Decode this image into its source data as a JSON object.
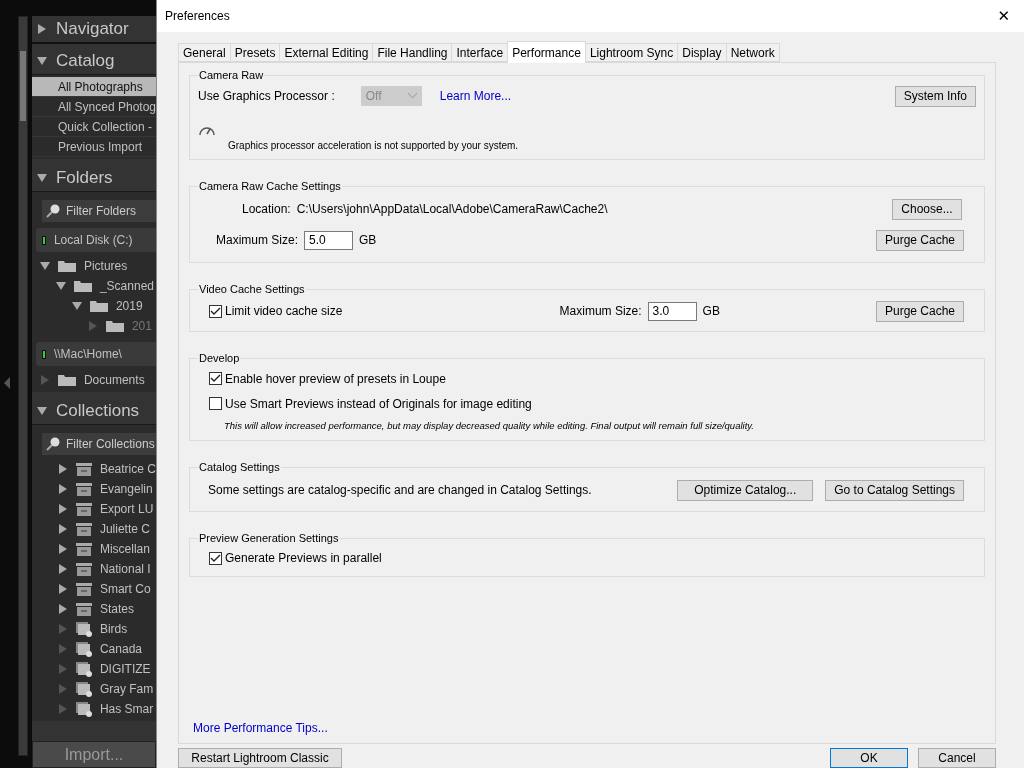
{
  "sidebar": {
    "sections": [
      {
        "kind": "navigator",
        "title": "Navigator",
        "expanded": false
      },
      {
        "kind": "catalog",
        "title": "Catalog",
        "expanded": true,
        "items": [
          {
            "label": "All Photographs",
            "selected": true
          },
          {
            "label": "All Synced Photog",
            "selected": false
          },
          {
            "label": "Quick Collection  -",
            "selected": false
          },
          {
            "label": "Previous Import",
            "selected": false
          }
        ]
      },
      {
        "kind": "folders",
        "title": "Folders",
        "expanded": true,
        "filter": "Filter Folders",
        "volumes": [
          {
            "label": "Local Disk (C:)",
            "folders": [
              {
                "label": "Pictures",
                "children": [
                  {
                    "label": "_Scanned",
                    "children": [
                      {
                        "label": "2019",
                        "children": [
                          {
                            "label": "201",
                            "dimmed": true
                          }
                        ]
                      }
                    ]
                  }
                ]
              }
            ]
          },
          {
            "label": "\\\\Mac\\Home\\",
            "folders": [
              {
                "label": "Documents"
              }
            ]
          }
        ]
      },
      {
        "kind": "collections",
        "title": "Collections",
        "expanded": true,
        "filter": "Filter Collections",
        "items": [
          {
            "label": "Beatrice C",
            "kind": "set"
          },
          {
            "label": "Evangelin",
            "kind": "set"
          },
          {
            "label": "Export LU",
            "kind": "set"
          },
          {
            "label": "Juliette C",
            "kind": "set"
          },
          {
            "label": "Miscellan",
            "kind": "set"
          },
          {
            "label": "National I",
            "kind": "set"
          },
          {
            "label": "Smart Co",
            "kind": "set"
          },
          {
            "label": "States",
            "kind": "set"
          },
          {
            "label": "Birds",
            "kind": "smart"
          },
          {
            "label": "Canada",
            "kind": "smart"
          },
          {
            "label": "DIGITIZE",
            "kind": "smart"
          },
          {
            "label": "Gray Fam",
            "kind": "smart"
          },
          {
            "label": "Has Smar",
            "kind": "smart"
          }
        ]
      }
    ],
    "import_button": "Import..."
  },
  "dialog": {
    "title": "Preferences",
    "close": "✕",
    "tabs": [
      {
        "label": "General",
        "selected": false
      },
      {
        "label": "Presets",
        "selected": false
      },
      {
        "label": "External Editing",
        "selected": false
      },
      {
        "label": "File Handling",
        "selected": false
      },
      {
        "label": "Interface",
        "selected": false
      },
      {
        "label": "Performance",
        "selected": true
      },
      {
        "label": "Lightroom Sync",
        "selected": false
      },
      {
        "label": "Display",
        "selected": false
      },
      {
        "label": "Network",
        "selected": false
      }
    ],
    "camera_raw": {
      "title": "Camera Raw",
      "gpu_label": "Use Graphics Processor :",
      "gpu_select": {
        "value": "Off",
        "disabled": true
      },
      "learn_more": "Learn More...",
      "system_info": "System Info",
      "notice": "Graphics processor acceleration is not supported by your system."
    },
    "cache": {
      "title": "Camera Raw Cache Settings",
      "location_label": "Location:",
      "location": "C:\\Users\\john\\AppData\\Local\\Adobe\\CameraRaw\\Cache2\\",
      "choose": "Choose...",
      "size_label": "Maximum Size:",
      "size": "5.0",
      "unit": "GB",
      "purge": "Purge Cache"
    },
    "video_cache": {
      "title": "Video Cache Settings",
      "limit": {
        "label": "Limit video cache size",
        "checked": true
      },
      "size_label": "Maximum Size:",
      "size": "3.0",
      "unit": "GB",
      "purge": "Purge Cache"
    },
    "develop": {
      "title": "Develop",
      "options": [
        {
          "label": "Enable hover preview of presets in Loupe",
          "checked": true
        },
        {
          "label": "Use Smart Previews instead of Originals for image editing",
          "checked": false
        }
      ],
      "note": "This will allow increased performance, but may display decreased quality while editing. Final output will remain full size/quality."
    },
    "catalog": {
      "title": "Catalog Settings",
      "text": "Some settings are catalog-specific and are changed in Catalog Settings.",
      "buttons": [
        "Optimize Catalog...",
        "Go to Catalog Settings"
      ]
    },
    "previews": {
      "title": "Preview Generation Settings",
      "parallel": {
        "label": "Generate Previews in parallel",
        "checked": true
      }
    },
    "tips_link": "More Performance Tips...",
    "footer": {
      "restart": "Restart Lightroom Classic",
      "ok": "OK",
      "cancel": "Cancel"
    }
  }
}
